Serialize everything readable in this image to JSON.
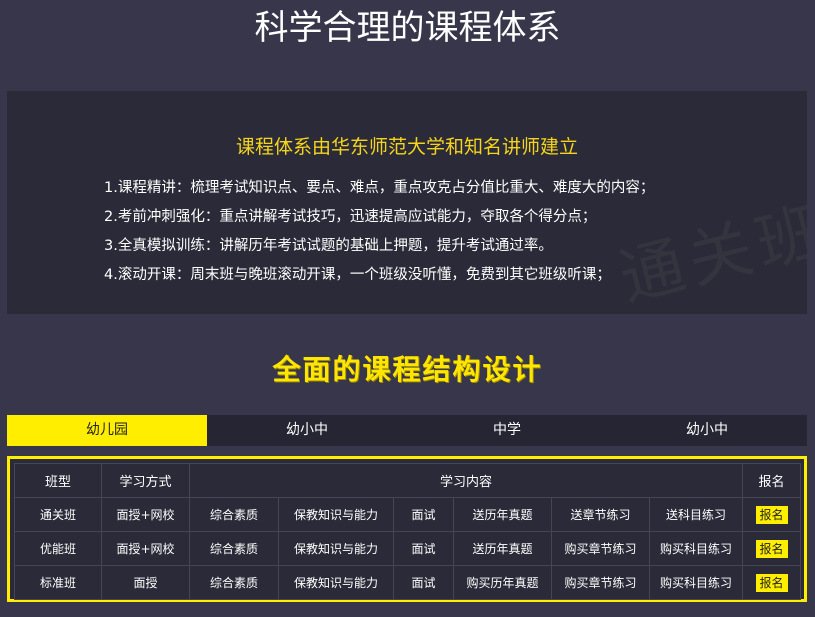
{
  "page_title": "科学合理的课程体系",
  "info": {
    "heading": "课程体系由华东师范大学和知名讲师建立",
    "lines": [
      "1.课程精讲：梳理考试知识点、要点、难点，重点攻克占分值比重大、难度大的内容；",
      "2.考前冲刺强化：重点讲解考试技巧，迅速提高应试能力，夺取各个得分点；",
      "3.全真模拟训练：讲解历年考试试题的基础上押题，提升考试通过率。",
      "4.滚动开课：周末班与晚班滚动开课，一个班级没听懂，免费到其它班级听课；"
    ],
    "watermark": "通关班"
  },
  "section_title": "全面的课程结构设计",
  "tabs": [
    "幼儿园",
    "幼小中",
    "中学",
    "幼小中"
  ],
  "table": {
    "headers": {
      "type": "班型",
      "method": "学习方式",
      "content": "学习内容",
      "signup": "报名"
    },
    "rows": [
      {
        "type": "通关班",
        "method": "面授+网校",
        "c1": "综合素质",
        "c2": "保教知识与能力",
        "c3": "面试",
        "c4": "送历年真题",
        "c5": "送章节练习",
        "c6": "送科目练习",
        "signup": "报名"
      },
      {
        "type": "优能班",
        "method": "面授+网校",
        "c1": "综合素质",
        "c2": "保教知识与能力",
        "c3": "面试",
        "c4": "送历年真题",
        "c5": "购买章节练习",
        "c6": "购买科目练习",
        "signup": "报名"
      },
      {
        "type": "标准班",
        "method": "面授",
        "c1": "综合素质",
        "c2": "保教知识与能力",
        "c3": "面试",
        "c4": "购买历年真题",
        "c5": "购买章节练习",
        "c6": "购买科目练习",
        "signup": "报名"
      }
    ]
  },
  "colors": {
    "accent": "#ffee00",
    "background": "#37364a",
    "panel": "#2a2a38",
    "heading_gold": "#f5d51a"
  }
}
